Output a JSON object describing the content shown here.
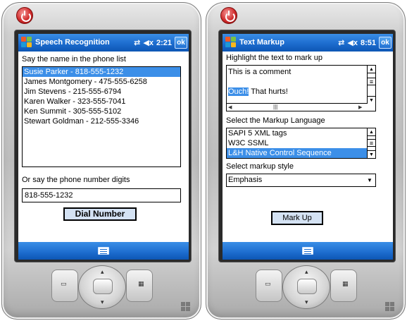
{
  "left": {
    "title": "Speech Recognition",
    "clock": "2:21",
    "ok_label": "ok",
    "name_prompt": "Say the name in the phone list",
    "contacts": [
      "Susie Parker - 818-555-1232",
      "James Montgomery - 475-555-6258",
      "Jim Stevens - 215-555-6794",
      "Karen Walker - 323-555-7041",
      "Ken Summit - 305-555-5102",
      "Stewart Goldman - 212-555-3346"
    ],
    "digits_prompt": "Or say the phone number digits",
    "phone_value": "818-555-1232",
    "dial_label": "Dial Number"
  },
  "right": {
    "title": "Text Markup",
    "clock": "8:51",
    "ok_label": "ok",
    "highlight_prompt": "Highlight the text to mark up",
    "text_line1": "This is a comment",
    "text_highlight": "Ouch!",
    "text_rest": " That hurts!",
    "language_prompt": "Select the Markup Language",
    "languages": [
      "SAPI 5 XML tags",
      "W3C SSML",
      "L&H Native Control Sequence"
    ],
    "style_prompt": "Select markup style",
    "style_value": "Emphasis",
    "markup_label": "Mark Up"
  },
  "colors": {
    "titlebar": "#1f6fd1",
    "selection": "#3c8fe8",
    "button_face": "#d4e2f3"
  }
}
